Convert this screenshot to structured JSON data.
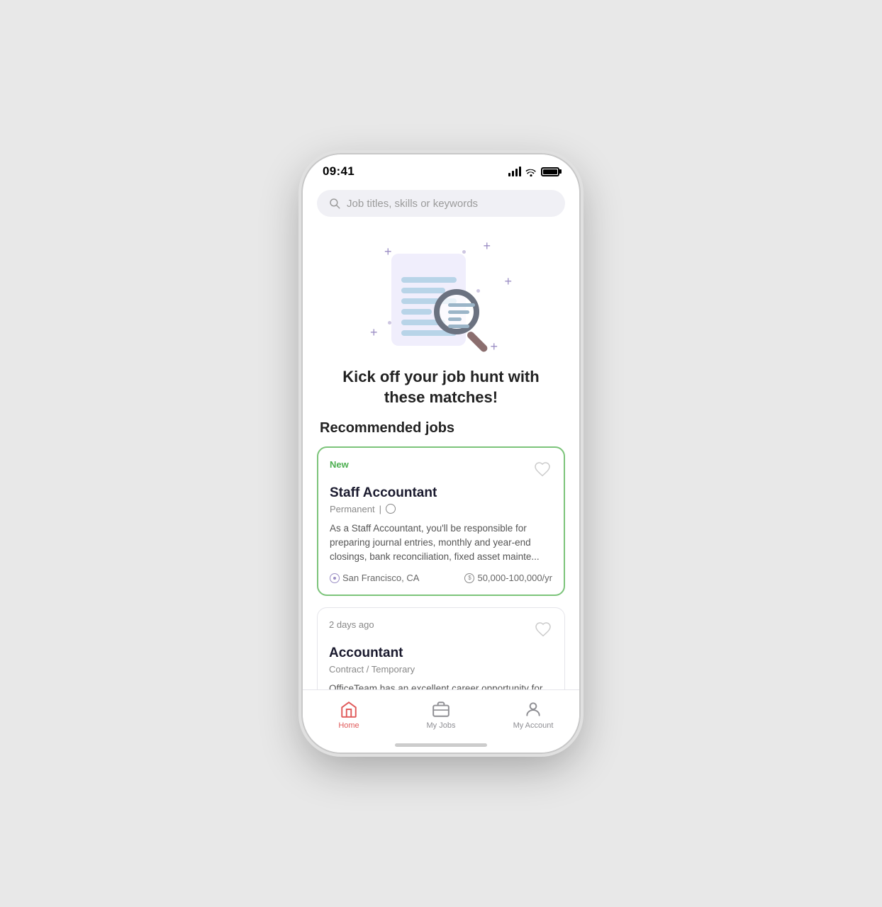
{
  "status": {
    "time": "09:41"
  },
  "search": {
    "placeholder": "Job titles, skills or keywords"
  },
  "hero": {
    "title": "Kick off your job hunt with these matches!"
  },
  "recommended": {
    "section_title": "Recommended jobs",
    "jobs": [
      {
        "id": 1,
        "badge": "New",
        "title": "Staff Accountant",
        "meta_type": "Permanent",
        "has_globe": true,
        "description": "As a Staff Accountant, you'll be responsible for preparing journal entries, monthly and year-end closings, bank reconciliation, fixed asset mainte...",
        "location": "San Francisco, CA",
        "salary": "50,000-100,000/yr",
        "featured": true
      },
      {
        "id": 2,
        "badge": "2 days ago",
        "title": "Accountant",
        "meta_type": "Contract / Temporary",
        "has_globe": false,
        "description": "OfficeTeam has an excellent career opportunity for an articulate, highly skilled accountant. Do you",
        "location": "",
        "salary": "",
        "featured": false
      }
    ]
  },
  "nav": {
    "items": [
      {
        "id": "home",
        "label": "Home",
        "active": true
      },
      {
        "id": "my-jobs",
        "label": "My Jobs",
        "active": false
      },
      {
        "id": "my-account",
        "label": "My Account",
        "active": false
      }
    ]
  }
}
